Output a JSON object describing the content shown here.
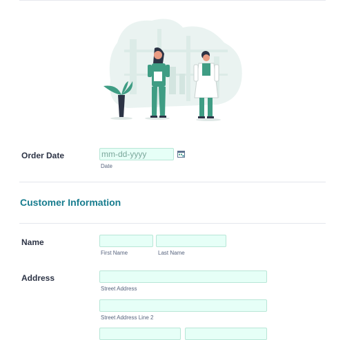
{
  "order_date": {
    "label": "Order Date",
    "placeholder": "mm-dd-yyyy",
    "sublabel": "Date",
    "icon": "calendar-icon"
  },
  "customer_section": {
    "title": "Customer Information"
  },
  "name": {
    "label": "Name",
    "first_sublabel": "First Name",
    "last_sublabel": "Last Name",
    "first_value": "",
    "last_value": ""
  },
  "address": {
    "label": "Address",
    "street_sublabel": "Street Address",
    "street2_sublabel": "Street Address Line 2"
  },
  "colors": {
    "accent": "#177c8e",
    "field_bg": "#e6fff7",
    "field_border": "#b7e6d6",
    "figure_green": "#3f9d84"
  }
}
